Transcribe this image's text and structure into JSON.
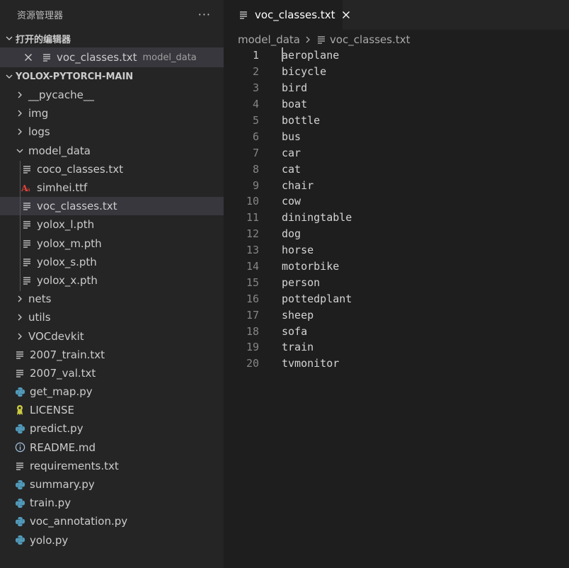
{
  "explorer": {
    "title": "资源管理器",
    "more_label": "···",
    "open_editors_title": "打开的编辑器",
    "open_editor": {
      "name": "voc_classes.txt",
      "desc": "model_data"
    },
    "project_title": "YOLOX-PYTORCH-MAIN",
    "tree": [
      {
        "label": "__pycache__",
        "type": "folder",
        "depth": 1
      },
      {
        "label": "img",
        "type": "folder",
        "depth": 1
      },
      {
        "label": "logs",
        "type": "folder",
        "depth": 1
      },
      {
        "label": "model_data",
        "type": "folder-open",
        "depth": 1
      },
      {
        "label": "coco_classes.txt",
        "type": "text-file",
        "depth": 2
      },
      {
        "label": "simhei.ttf",
        "type": "font-file",
        "depth": 2
      },
      {
        "label": "voc_classes.txt",
        "type": "text-file",
        "depth": 2,
        "active": true
      },
      {
        "label": "yolox_l.pth",
        "type": "text-file",
        "depth": 2
      },
      {
        "label": "yolox_m.pth",
        "type": "text-file",
        "depth": 2
      },
      {
        "label": "yolox_s.pth",
        "type": "text-file",
        "depth": 2
      },
      {
        "label": "yolox_x.pth",
        "type": "text-file",
        "depth": 2
      },
      {
        "label": "nets",
        "type": "folder",
        "depth": 1
      },
      {
        "label": "utils",
        "type": "folder",
        "depth": 1
      },
      {
        "label": "VOCdevkit",
        "type": "folder",
        "depth": 1
      },
      {
        "label": "2007_train.txt",
        "type": "text-file",
        "depth": 1
      },
      {
        "label": "2007_val.txt",
        "type": "text-file",
        "depth": 1
      },
      {
        "label": "get_map.py",
        "type": "python-file",
        "depth": 1
      },
      {
        "label": "LICENSE",
        "type": "license-file",
        "depth": 1
      },
      {
        "label": "predict.py",
        "type": "python-file",
        "depth": 1
      },
      {
        "label": "README.md",
        "type": "info-file",
        "depth": 1
      },
      {
        "label": "requirements.txt",
        "type": "text-file",
        "depth": 1
      },
      {
        "label": "summary.py",
        "type": "python-file",
        "depth": 1
      },
      {
        "label": "train.py",
        "type": "python-file",
        "depth": 1
      },
      {
        "label": "voc_annotation.py",
        "type": "python-file",
        "depth": 1
      },
      {
        "label": "yolo.py",
        "type": "python-file",
        "depth": 1
      }
    ]
  },
  "editor": {
    "tab_label": "voc_classes.txt",
    "breadcrumb": {
      "folder": "model_data",
      "file": "voc_classes.txt"
    },
    "current_line": 1,
    "lines": [
      "aeroplane",
      "bicycle",
      "bird",
      "boat",
      "bottle",
      "bus",
      "car",
      "cat",
      "chair",
      "cow",
      "diningtable",
      "dog",
      "horse",
      "motorbike",
      "person",
      "pottedplant",
      "sheep",
      "sofa",
      "train",
      "tvmonitor"
    ]
  },
  "colors": {
    "python_icon": "#519aba",
    "font_icon": "#e0433a",
    "license_icon": "#cbcb41",
    "info_icon": "#a7c4e1"
  }
}
